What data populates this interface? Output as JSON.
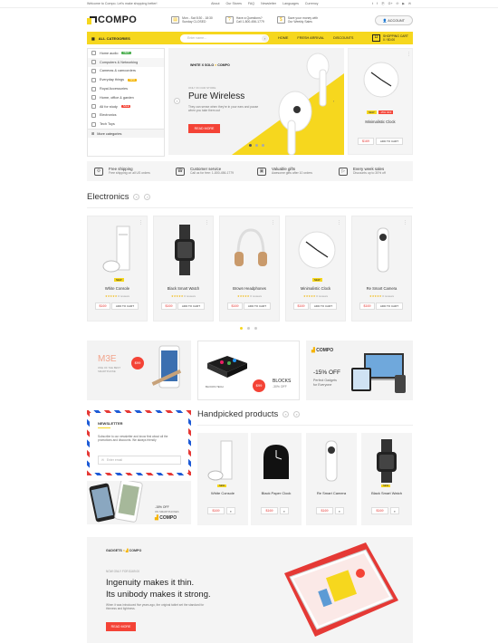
{
  "topbar": {
    "welcome": "Welcome to Compo. Let's make shopping better!",
    "links": [
      "About",
      "Our Stores",
      "FAQ",
      "Newsletter",
      "Languages",
      "Currency"
    ],
    "social": [
      "t",
      "f",
      "Ⓟ",
      "G+",
      "℗",
      "▶",
      "✉"
    ]
  },
  "header": {
    "logo": "COMPO",
    "hours_1": "Mon - Sat 8:30 - 18:30",
    "hours_2": "Sunday CLOSED",
    "q_1": "Have a Questions?",
    "q_2": "Call 1-800-456-1779",
    "save_1": "Save your money with",
    "save_2": "Our Weekly Sales",
    "account": "ACCOUNT"
  },
  "nav": {
    "all_categories": "ALL CATEGORIES",
    "search_placeholder": "Enter name...",
    "links": [
      "HOME",
      "FRESH ARRIVAL",
      "DISCOUNTS"
    ],
    "cart_1": "SHOPPING CART",
    "cart_2": "0 / $0.00"
  },
  "sidebar": {
    "items": [
      {
        "label": "Home audio",
        "tag": "NEW",
        "tag_color": "#4caf50"
      },
      {
        "label": "Computers & Networking",
        "tag": "",
        "tag_color": ""
      },
      {
        "label": "Cameras & camcorders",
        "tag": "",
        "tag_color": ""
      },
      {
        "label": "Everyday things",
        "tag": "NEW",
        "tag_color": "#f4b400"
      },
      {
        "label": "Royal Accessories",
        "tag": "",
        "tag_color": ""
      },
      {
        "label": "Home, office & garden",
        "tag": "",
        "tag_color": ""
      },
      {
        "label": "All for study",
        "tag": "SALE",
        "tag_color": "#f44336"
      },
      {
        "label": "Electronics",
        "tag": "",
        "tag_color": ""
      },
      {
        "label": "Tech Toys",
        "tag": "",
        "tag_color": ""
      }
    ],
    "more": "More categories"
  },
  "hero": {
    "brand": "WHITE X SOLO",
    "brand2": "COMPO",
    "kicker": "ONLY IN OUR STORE",
    "title": "Pure Wireless",
    "text": "They can sense when they're in your ears and pause when you take them out",
    "button": "READ MORE"
  },
  "side_product": {
    "name": "Minimalistic Clock",
    "badge": "NEW",
    "sale": "-15% OFF",
    "price": "$169",
    "add": "ADD TO CART"
  },
  "features": [
    {
      "title": "Free shipping",
      "sub": "Free shipping on all US orders",
      "icon": "⚙"
    },
    {
      "title": "Customer service",
      "sub": "Call us for free: 1-800-456-1779",
      "icon": "☎"
    },
    {
      "title": "Valuable gifts",
      "sub": "Awesome gifts after 10 orders",
      "icon": "▣"
    },
    {
      "title": "Every week sales",
      "sub": "Discounts up to 30% off",
      "icon": "▷"
    }
  ],
  "electronics": {
    "title": "Electronics",
    "products": [
      {
        "name": "White Console",
        "price": "$169",
        "badge": "NEW",
        "add": "ADD TO CART",
        "reviews": "0 reviews"
      },
      {
        "name": "Black Smart Watch",
        "price": "$169",
        "badge": "",
        "add": "ADD TO CART",
        "reviews": "0 reviews"
      },
      {
        "name": "Brown Headphones",
        "price": "$169",
        "badge": "",
        "add": "ADD TO CART",
        "reviews": "0 reviews"
      },
      {
        "name": "Minimalistic Clock",
        "price": "$169",
        "badge": "NEW",
        "add": "ADD TO CART",
        "reviews": "0 reviews"
      },
      {
        "name": "Re Smart Camera",
        "price": "$169",
        "badge": "",
        "add": "ADD TO CART",
        "reviews": "0 reviews"
      }
    ]
  },
  "banners": {
    "m3e": "M3E",
    "m3e_sub": "ONE OF THE BEST SMARTPHONE",
    "m3e_price": "$99",
    "blocks": "BLOCKS",
    "blocks_sub": "-30% OFF",
    "blocks_tag": "BLOCKS TECH",
    "blocks_price": "$99",
    "compo": "COMPO",
    "compo_off": "-15% OFF",
    "compo_text_1": "Perfect Gadgets",
    "compo_text_2": "for Everyone"
  },
  "newsletter": {
    "title": "NEWSLETTER",
    "text": "Subscribe to our newsletter and know first about all the promotions and discounts. We always friendly",
    "placeholder": "Enter email"
  },
  "phones_banner": {
    "off": "-15% OFF",
    "sub": "ON SMARTPHONES",
    "brand": "COMPO"
  },
  "handpicked": {
    "title": "Handpicked products",
    "products": [
      {
        "name": "White Console",
        "price": "$169",
        "badge": "NEW"
      },
      {
        "name": "Black Paper Clock",
        "price": "$169",
        "badge": ""
      },
      {
        "name": "Re Smart Camera",
        "price": "$169",
        "badge": ""
      },
      {
        "name": "Black Smart Watch",
        "price": "$169",
        "badge": "NEW"
      }
    ]
  },
  "bottom": {
    "brand": "GADGETS",
    "brand2": "COMPO",
    "kicker": "NOW ONLY FOR $169.00",
    "line1": "Ingenuity makes it thin.",
    "line2": "Its unibody makes it strong.",
    "text": "When it was introduced five years ago, the original tablet set the standard for thinness and lightness.",
    "button": "READ MORE"
  }
}
